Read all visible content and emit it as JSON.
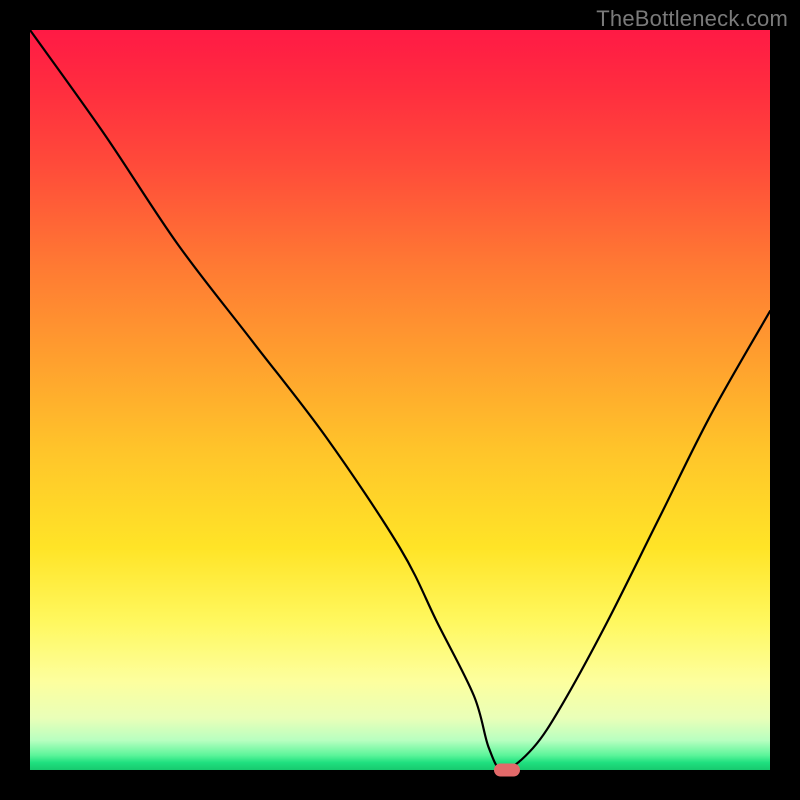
{
  "watermark": "TheBottleneck.com",
  "chart_data": {
    "type": "line",
    "title": "",
    "xlabel": "",
    "ylabel": "",
    "xlim": [
      0,
      100
    ],
    "ylim": [
      0,
      100
    ],
    "series": [
      {
        "name": "bottleneck-curve",
        "x": [
          0,
          10,
          20,
          30,
          40,
          50,
          55,
          60,
          62,
          64,
          68,
          72,
          78,
          85,
          92,
          100
        ],
        "values": [
          100,
          86,
          71,
          58,
          45,
          30,
          20,
          10,
          3,
          0,
          3,
          9,
          20,
          34,
          48,
          62
        ]
      }
    ],
    "marker": {
      "x": 64.5,
      "y": 0,
      "color": "#e26a6a"
    },
    "gradient_stops": [
      {
        "pos": 0,
        "color": "#ff1a45"
      },
      {
        "pos": 8,
        "color": "#ff2d3f"
      },
      {
        "pos": 18,
        "color": "#ff4a3a"
      },
      {
        "pos": 32,
        "color": "#ff7a33"
      },
      {
        "pos": 45,
        "color": "#ffa12e"
      },
      {
        "pos": 57,
        "color": "#ffc52a"
      },
      {
        "pos": 70,
        "color": "#ffe427"
      },
      {
        "pos": 80,
        "color": "#fff85f"
      },
      {
        "pos": 88,
        "color": "#fdff9e"
      },
      {
        "pos": 93,
        "color": "#e9ffb8"
      },
      {
        "pos": 96,
        "color": "#b8ffc0"
      },
      {
        "pos": 98,
        "color": "#5cf59a"
      },
      {
        "pos": 99,
        "color": "#1fe07f"
      },
      {
        "pos": 100,
        "color": "#17c96e"
      }
    ]
  }
}
